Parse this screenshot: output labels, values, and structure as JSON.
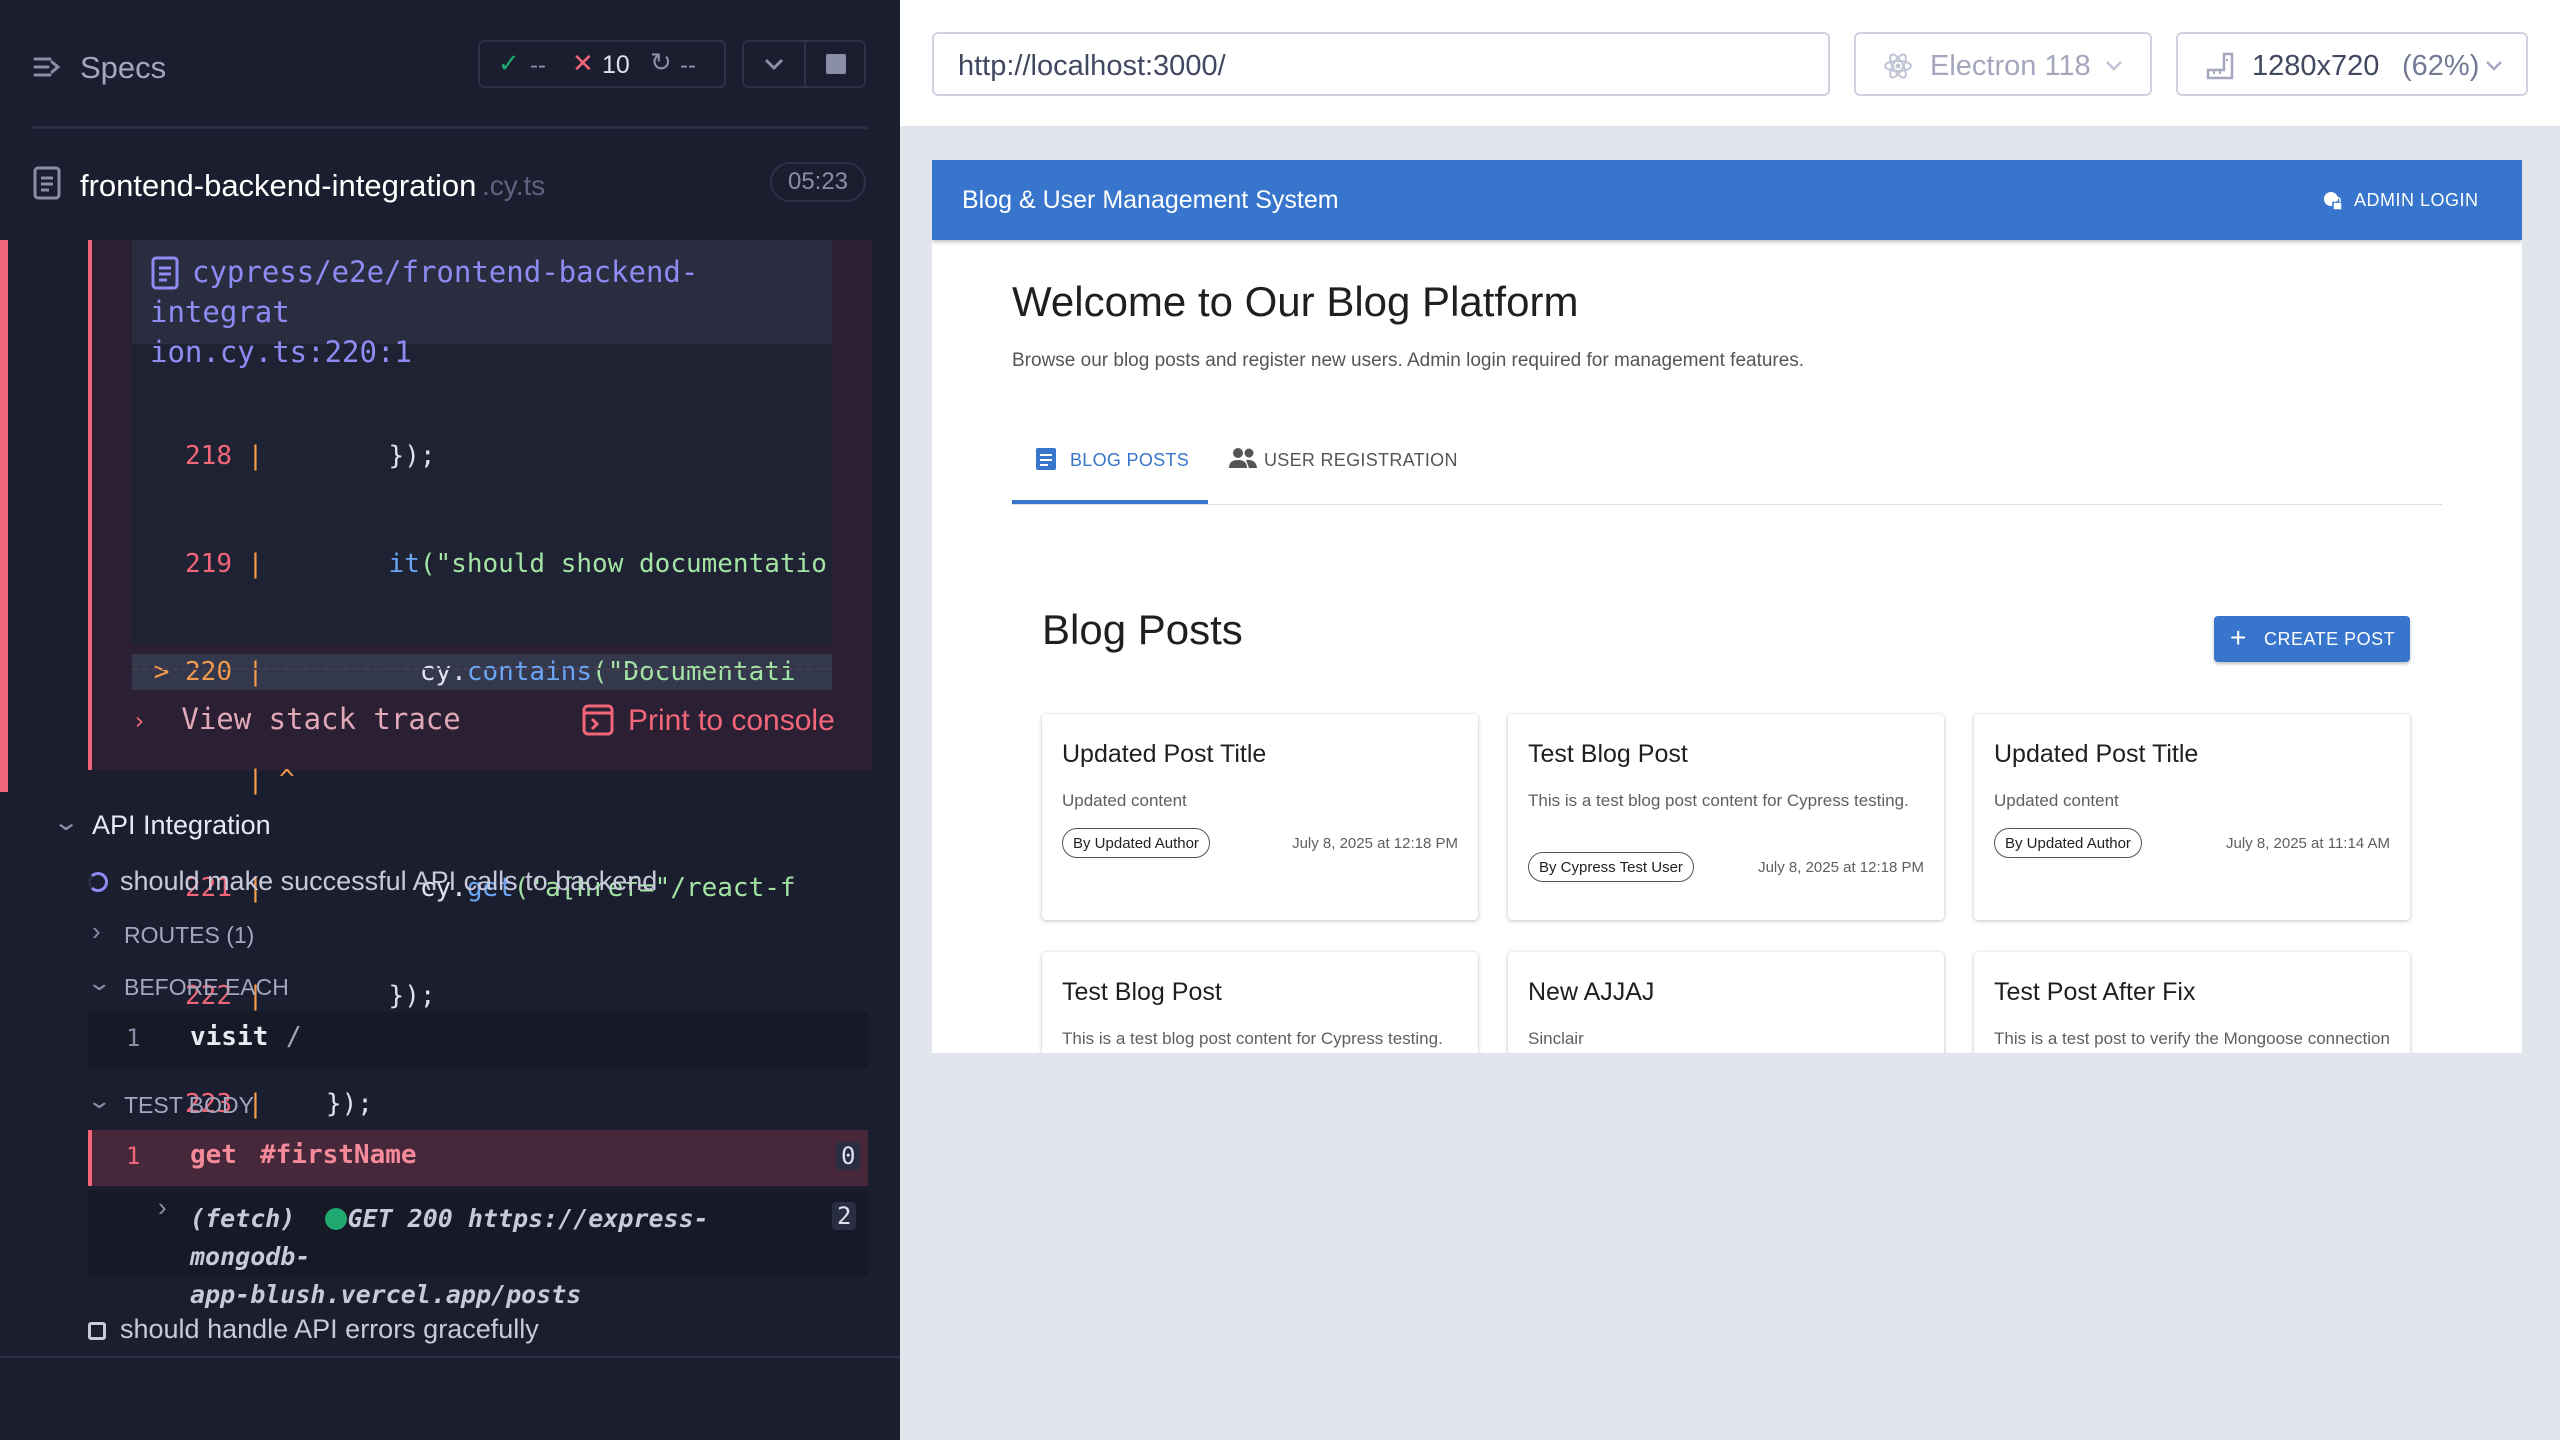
{
  "reporter": {
    "header": {
      "specs_label": "Specs",
      "passed": "--",
      "failed": "10",
      "pending": "--"
    },
    "spec": {
      "name": "frontend-backend-integration",
      "ext": ".cy.ts",
      "duration": "05:23"
    },
    "error": {
      "file_line1": "cypress/e2e/frontend-backend-integrat",
      "file_line2": "ion.cy.ts:220:1",
      "code": [
        {
          "num": "218",
          "marker": "|",
          "text": "        });"
        },
        {
          "num": "219",
          "marker": "|",
          "pre": "        ",
          "fn": "it",
          "str": "(\"should show documentatio"
        },
        {
          "num": "220",
          "prefix": "> ",
          "marker": "|",
          "pre": "          cy.",
          "fn": "contains",
          "str": "(\"Documentati"
        },
        {
          "num": "",
          "marker": "| ^"
        },
        {
          "num": "221",
          "marker": "|",
          "pre": "          cy.",
          "fn": "get",
          "str": "('a[href=\"/react-f"
        },
        {
          "num": "222",
          "marker": "|",
          "text": "        });"
        },
        {
          "num": "223",
          "marker": "|",
          "text": "    });"
        }
      ],
      "view_stack": "View stack trace",
      "print_console": "Print to console"
    },
    "suite": {
      "title": "API Integration",
      "test1": "should make successful API calls to backend",
      "routes": "ROUTES (1)",
      "before_each": "BEFORE EACH",
      "be_num": "1",
      "be_cmd": "visit",
      "be_arg": "/",
      "test_body": "TEST BODY",
      "tb_num": "1",
      "tb_cmd": "get",
      "tb_arg": "#firstName",
      "tb_count": "0",
      "fetch_label": "(fetch)",
      "fetch_text1": "GET 200 https://express-mongodb-",
      "fetch_text2": "app-blush.vercel.app/posts",
      "fetch_count": "2",
      "test2": "should handle API errors gracefully"
    }
  },
  "aut": {
    "url": "http://localhost:3000/",
    "browser": "Electron 118",
    "viewport": "1280x720",
    "zoom": "(62%)"
  },
  "app": {
    "title": "Blog & User Management System",
    "admin_login": "ADMIN LOGIN",
    "welcome": "Welcome to Our Blog Platform",
    "subtitle": "Browse our blog posts and register new users. Admin login required for management features.",
    "tabs": [
      "BLOG POSTS",
      "USER REGISTRATION"
    ],
    "section_title": "Blog Posts",
    "create_post": "CREATE POST",
    "posts": [
      {
        "title": "Updated Post Title",
        "content": "Updated content",
        "author": "By Updated Author",
        "date": "July 8, 2025 at 12:18 PM"
      },
      {
        "title": "Test Blog Post",
        "content": "This is a test blog post content for Cypress testing.",
        "author": "By Cypress Test User",
        "date": "July 8, 2025 at 12:18 PM"
      },
      {
        "title": "Updated Post Title",
        "content": "Updated content",
        "author": "By Updated Author",
        "date": "July 8, 2025 at 11:14 AM"
      },
      {
        "title": "Test Blog Post",
        "content": "This is a test blog post content for Cypress testing.",
        "author": "",
        "date": ""
      },
      {
        "title": "New AJJAJ",
        "content": "Sinclair",
        "author": "",
        "date": ""
      },
      {
        "title": "Test Post After Fix",
        "content": "This is a test post to verify the Mongoose connection fix is working.",
        "author": "",
        "date": ""
      }
    ]
  },
  "colors": {
    "reporter_bg": "#1b1e2e",
    "appbar": "#3776cc",
    "fail": "#f3667a",
    "pass": "#1fa971",
    "accent": "#8e8cf4"
  }
}
